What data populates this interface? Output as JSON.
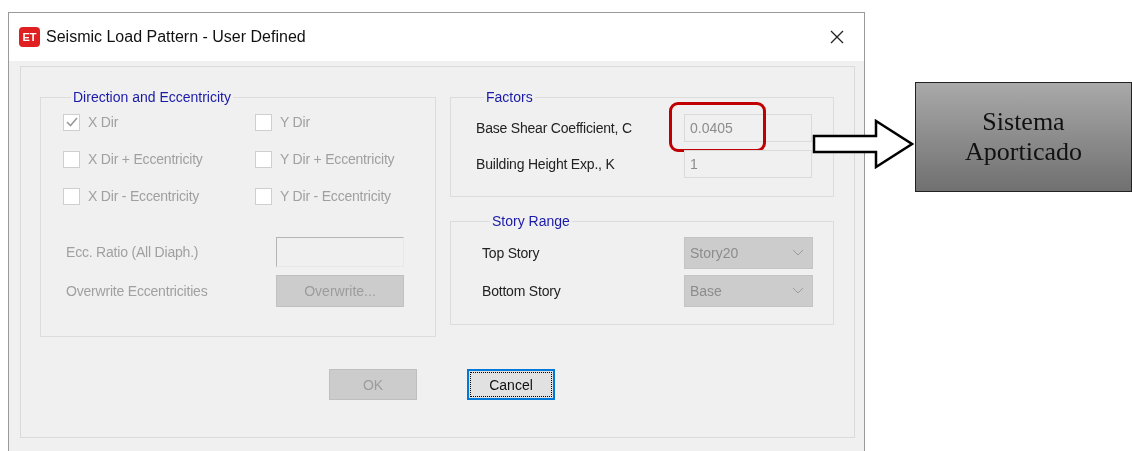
{
  "window": {
    "title": "Seismic Load Pattern - User Defined",
    "app_badge": "ET"
  },
  "direction_group": {
    "title": "Direction and Eccentricity",
    "disabled": true,
    "checkboxes": [
      {
        "label": "X Dir",
        "checked": true
      },
      {
        "label": "Y Dir",
        "checked": false
      },
      {
        "label": "X Dir + Eccentricity",
        "checked": false
      },
      {
        "label": "Y Dir + Eccentricity",
        "checked": false
      },
      {
        "label": "X Dir - Eccentricity",
        "checked": false
      },
      {
        "label": "Y Dir - Eccentricity",
        "checked": false
      }
    ],
    "ecc_ratio": {
      "label": "Ecc. Ratio (All Diaph.)"
    },
    "overwrite": {
      "label": "Overwrite Eccentricities",
      "button": "Overwrite..."
    }
  },
  "factors": {
    "title": "Factors",
    "fields": [
      {
        "label": "Base Shear Coefficient, C",
        "value": "0.0405",
        "highlighted": true
      },
      {
        "label": "Building Height Exp., K",
        "value": "1",
        "highlighted": false
      }
    ]
  },
  "story_range": {
    "title": "Story Range",
    "dropdowns": [
      {
        "label": "Top Story",
        "value": "Story20"
      },
      {
        "label": "Bottom Story",
        "value": "Base"
      }
    ]
  },
  "buttons": [
    {
      "label": "OK",
      "disabled": true,
      "focused": false
    },
    {
      "label": "Cancel",
      "disabled": false,
      "focused": true
    }
  ],
  "annotation": {
    "lines": [
      "Sistema",
      "Aporticado"
    ]
  }
}
